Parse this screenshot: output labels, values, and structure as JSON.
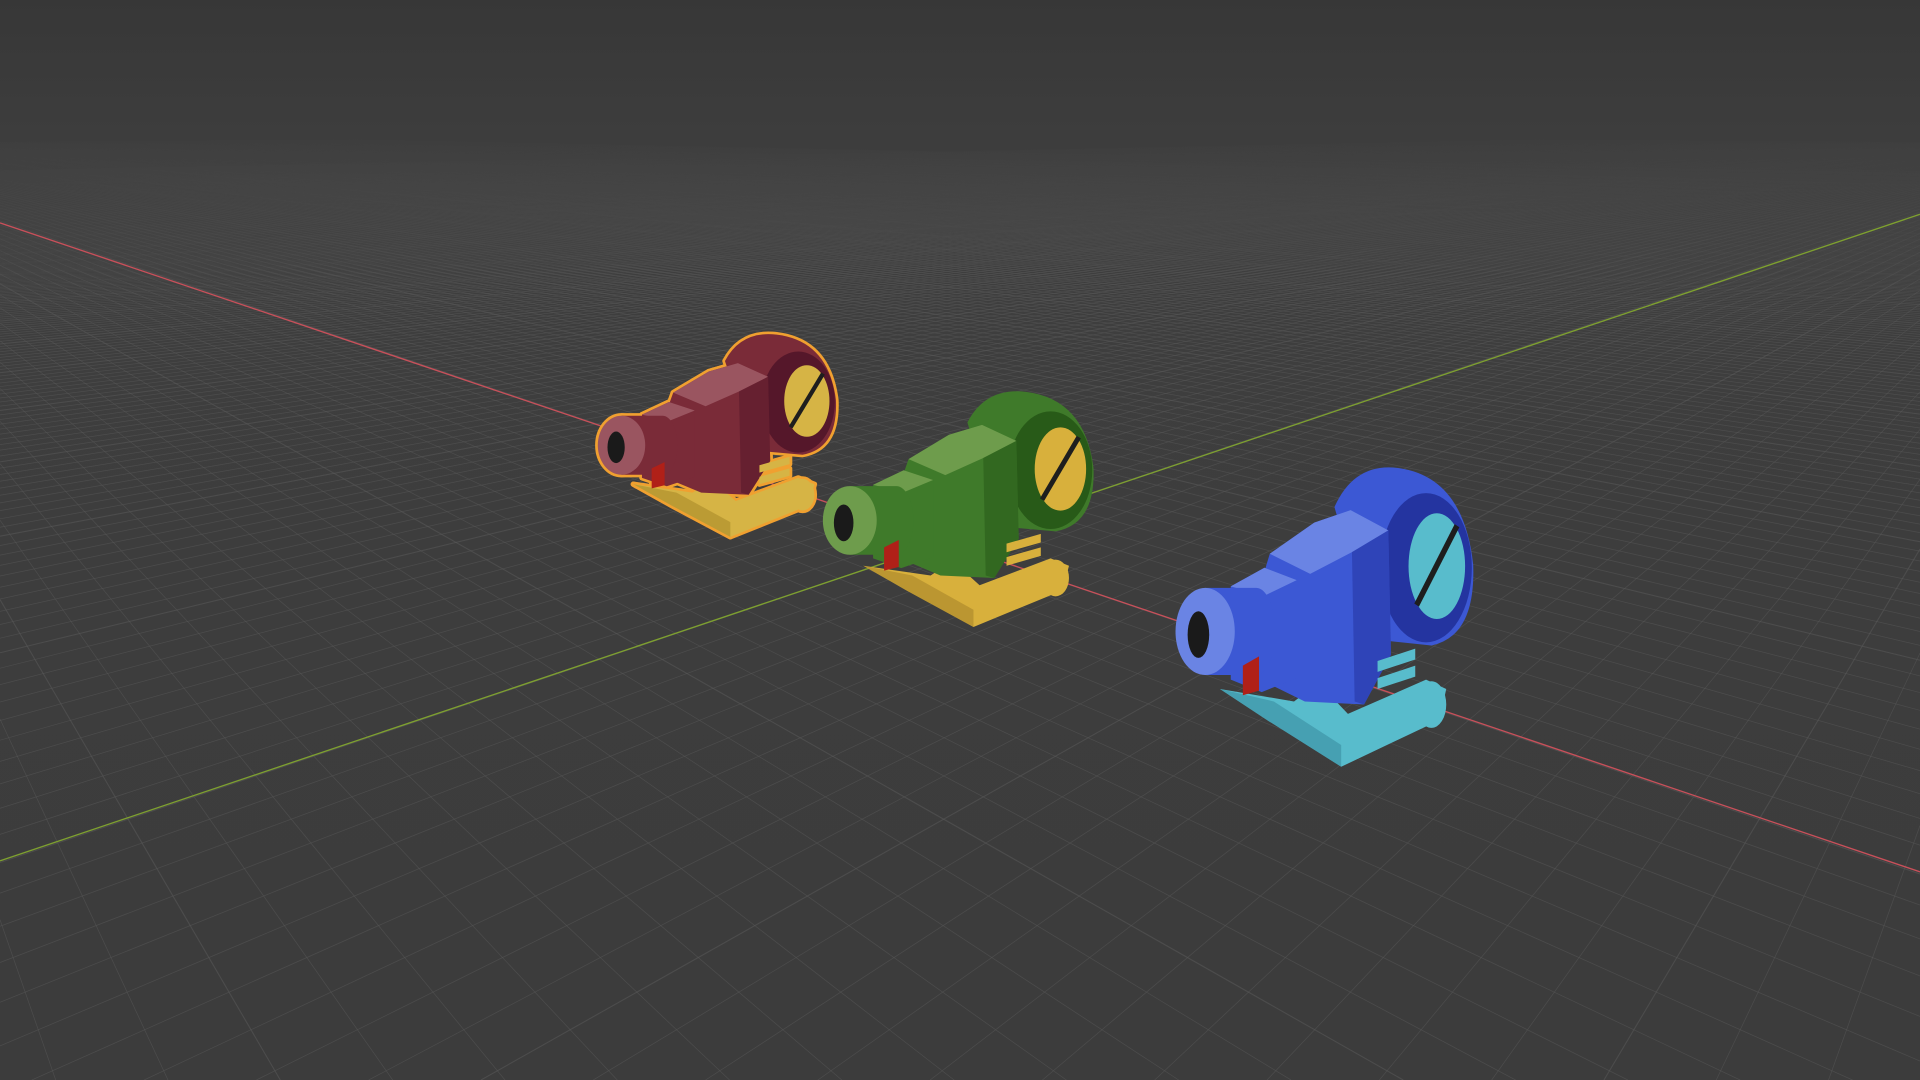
{
  "viewport": {
    "background_top": "#383838",
    "background_horizon": "#3e3e3e",
    "grid_color": "#5a5a5a",
    "axis_x_color": "#c8505a",
    "axis_y_color": "#7ea030",
    "selection_outline_color": "#f0a030"
  },
  "objects": [
    {
      "id": "turret-red",
      "selected": true,
      "body": "#7a2b38",
      "dark": "#55172a",
      "light": "#9a5560",
      "accent": "#d6b445",
      "accent_dark": "#a88a2a"
    },
    {
      "id": "turret-green",
      "selected": false,
      "body": "#3f7a2a",
      "dark": "#285a18",
      "light": "#6e9c4c",
      "accent": "#d8b03c",
      "accent_dark": "#a8862a"
    },
    {
      "id": "turret-blue",
      "selected": false,
      "body": "#3c58d4",
      "dark": "#2434a0",
      "light": "#6a84e4",
      "accent": "#58bccc",
      "accent_dark": "#3a8ea0"
    }
  ]
}
